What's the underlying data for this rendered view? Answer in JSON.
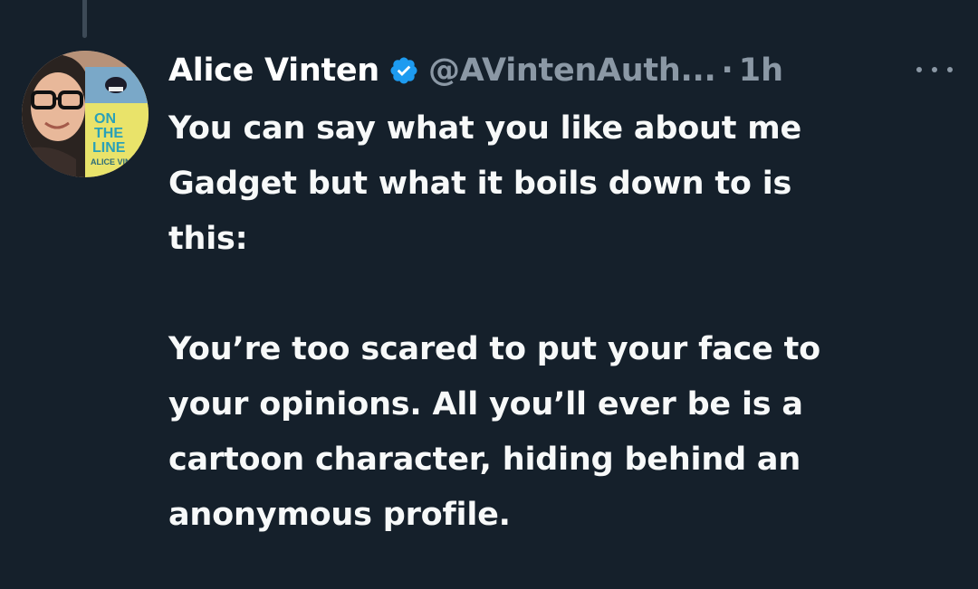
{
  "tweet": {
    "author_name": "Alice Vinten",
    "verified": true,
    "handle": "@AVintenAuth...",
    "separator": "·",
    "time": "1h",
    "more_icon": "more-horizontal-icon",
    "verified_icon": "verified-badge-icon",
    "verified_color": "#1d9bf0",
    "avatar": {
      "book_text": [
        "ON",
        "THE",
        "LINE"
      ],
      "book_author": "ALICE VIN"
    },
    "paragraph1_lines": [
      "You can say what you like about me",
      "Gadget but what it boils down to is",
      "this:"
    ],
    "paragraph2_lines": [
      "You’re too scared to put your face to",
      "your opinions. All you’ll ever be is a",
      "cartoon character, hiding behind an",
      "anonymous profile."
    ]
  },
  "colors": {
    "background": "#15202b",
    "text_primary": "#f7f9f9",
    "text_secondary": "#8b98a5",
    "thread_line": "#3d4a57"
  }
}
